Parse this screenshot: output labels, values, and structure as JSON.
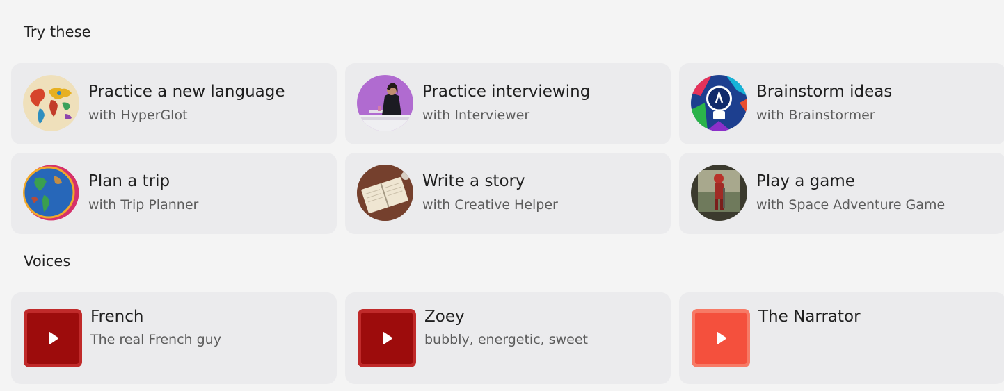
{
  "sections": {
    "try_title": "Try these",
    "voices_title": "Voices"
  },
  "try_cards": [
    {
      "title": "Practice a new language",
      "subtitle": "with HyperGlot",
      "avatar": "world-map-avatar"
    },
    {
      "title": "Practice interviewing",
      "subtitle": "with Interviewer",
      "avatar": "interviewer-avatar"
    },
    {
      "title": "Brainstorm ideas",
      "subtitle": "with Brainstormer",
      "avatar": "lightbulb-avatar"
    },
    {
      "title": "Plan a trip",
      "subtitle": "with Trip Planner",
      "avatar": "globe-avatar"
    },
    {
      "title": "Write a story",
      "subtitle": "with Creative Helper",
      "avatar": "notebook-avatar"
    },
    {
      "title": "Play a game",
      "subtitle": "with Space Adventure Game",
      "avatar": "astronaut-avatar"
    }
  ],
  "voices": [
    {
      "name": "French",
      "description": "The real French guy",
      "thumb_color": "#9d0c0c",
      "icon": "play-icon"
    },
    {
      "name": "Zoey",
      "description": "bubbly, energetic, sweet",
      "thumb_color": "#9d0c0c",
      "icon": "play-icon"
    },
    {
      "name": "The Narrator",
      "description": "",
      "thumb_color": "#f4503d",
      "icon": "play-icon"
    }
  ]
}
